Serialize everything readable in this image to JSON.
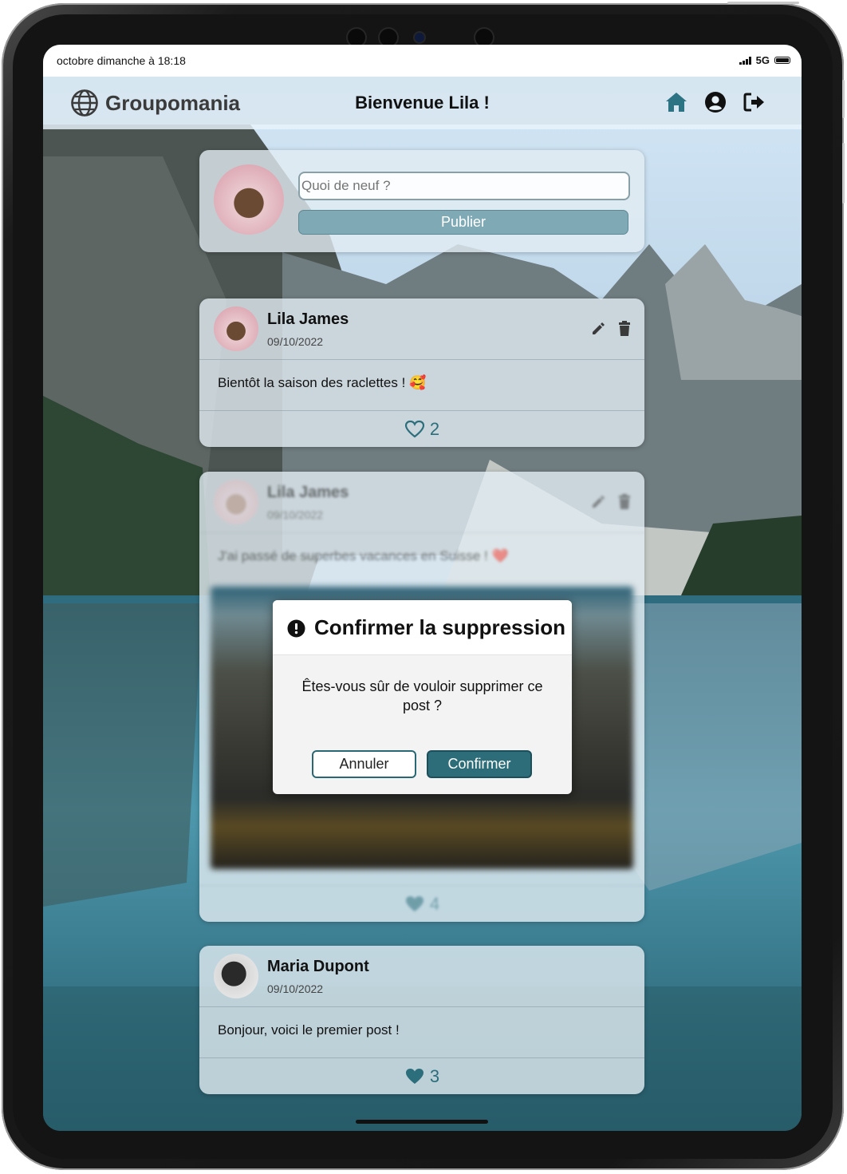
{
  "status_bar": {
    "time": "octobre dimanche à 18:18",
    "network": "5G"
  },
  "header": {
    "brand": "Groupomania",
    "welcome": "Bienvenue Lila !"
  },
  "nav": {
    "home_icon": "home-icon",
    "profile_icon": "user-circle-icon",
    "logout_icon": "logout-icon"
  },
  "compose": {
    "placeholder": "Quoi de neuf ?",
    "publish_label": "Publier"
  },
  "posts": [
    {
      "author": "Lila James",
      "date": "09/10/2022",
      "text": "Bientôt la saison des raclettes ! 🥰",
      "likes": "2",
      "liked": false
    },
    {
      "author": "Lila James",
      "date": "09/10/2022",
      "text": "J'ai passé de superbes vacances en Suisse ! ❤️",
      "likes": "4",
      "liked": true
    },
    {
      "author": "Maria Dupont",
      "date": "09/10/2022",
      "text": "Bonjour, voici le premier post !",
      "likes": "3",
      "liked": true
    }
  ],
  "modal": {
    "title": "Confirmer la suppression",
    "message": "Êtes-vous sûr de vouloir supprimer ce post ?",
    "cancel_label": "Annuler",
    "confirm_label": "Confirmer"
  },
  "colors": {
    "accent": "#2c6d79",
    "like": "#2c6e7b",
    "publish": "#7fa9b4"
  }
}
